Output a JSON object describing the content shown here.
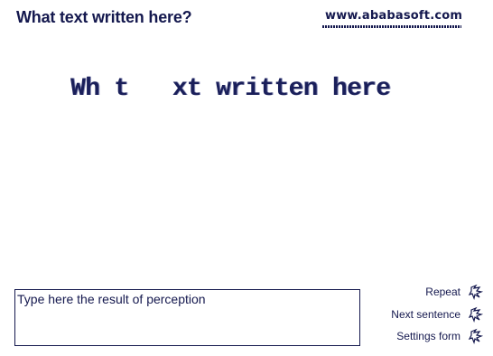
{
  "header": {
    "title": "What text written here?",
    "site": "www.ababasoft.com"
  },
  "puzzle": {
    "text": "Wh t   xt written here"
  },
  "answer": {
    "placeholder": "Type here the result of perception",
    "value": ""
  },
  "actions": [
    {
      "label": "Repeat",
      "icon": "spiral-arrow-icon"
    },
    {
      "label": "Next sentence",
      "icon": "spiral-arrow-icon"
    },
    {
      "label": "Settings form",
      "icon": "spiral-arrow-icon"
    }
  ],
  "colors": {
    "text": "#14184e",
    "background": "#ffffff"
  }
}
